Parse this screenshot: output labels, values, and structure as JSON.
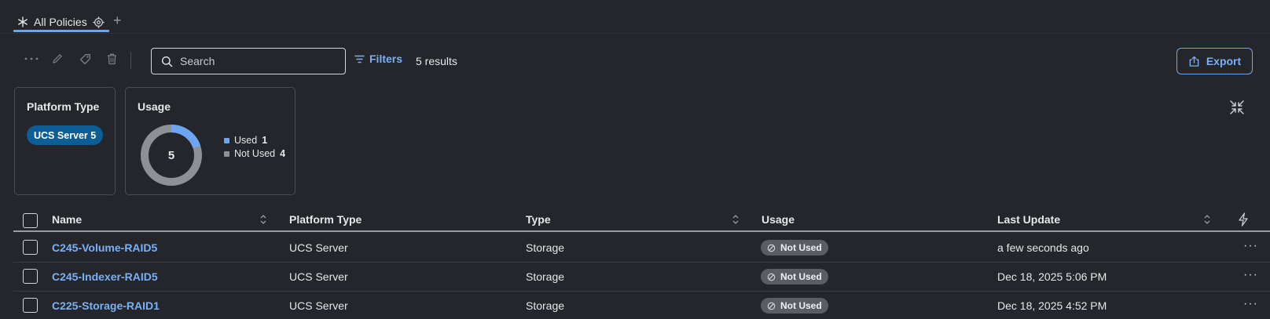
{
  "tab": {
    "label": "All Policies",
    "add": "+"
  },
  "toolbar": {
    "search_placeholder": "Search",
    "filters_label": "Filters",
    "results": "5 results",
    "export_label": "Export",
    "accent": "#6ea5f0"
  },
  "cards": {
    "platform": {
      "title": "Platform Type",
      "pill_label": "UCS Server 5"
    },
    "usage": {
      "title": "Usage",
      "total": "5",
      "used_label": "Used",
      "used_count": "1",
      "not_used_label": "Not Used",
      "not_used_count": "4",
      "used_color": "#6ea5f0",
      "not_used_color": "#8e9096"
    }
  },
  "table": {
    "columns": [
      "Name",
      "Platform Type",
      "Type",
      "Usage",
      "Last Update"
    ],
    "rows": [
      {
        "name": "C245-Volume-RAID5",
        "platform": "UCS Server",
        "type": "Storage",
        "usage": "Not Used",
        "last_update": "a few seconds ago"
      },
      {
        "name": "C245-Indexer-RAID5",
        "platform": "UCS Server",
        "type": "Storage",
        "usage": "Not Used",
        "last_update": "Dec 18, 2025 5:06 PM"
      },
      {
        "name": "C225-Storage-RAID1",
        "platform": "UCS Server",
        "type": "Storage",
        "usage": "Not Used",
        "last_update": "Dec 18, 2025 4:52 PM"
      }
    ],
    "row_more": "···"
  }
}
